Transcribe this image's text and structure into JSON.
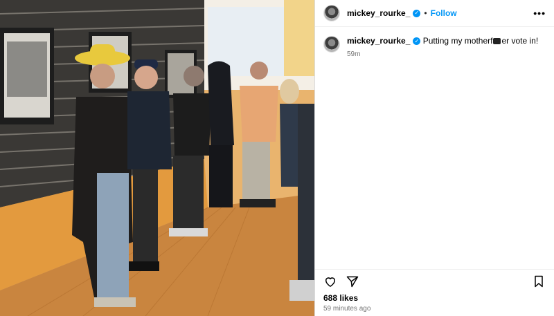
{
  "post": {
    "media_alt": "Photo of people standing in line inside a building with framed pictures on the wall",
    "author": {
      "username": "mickey_rourke_",
      "verified_glyph": "✓",
      "dot": "•",
      "follow_label": "Follow",
      "more_glyph": "•••"
    },
    "caption": {
      "username": "mickey_rourke_",
      "text_before": "Putting my motherf",
      "text_after": "er vote in!",
      "time": "59m"
    },
    "likes": "688 likes",
    "time_ago": "59 minutes ago"
  },
  "icons": {
    "author_avatar": "avatar",
    "verified": "verified-badge-icon",
    "like": "heart-icon",
    "share": "send-icon",
    "save": "bookmark-icon"
  },
  "colors": {
    "accent": "#0095f6",
    "secondary_text": "#737373",
    "border": "#dbdbdb"
  }
}
